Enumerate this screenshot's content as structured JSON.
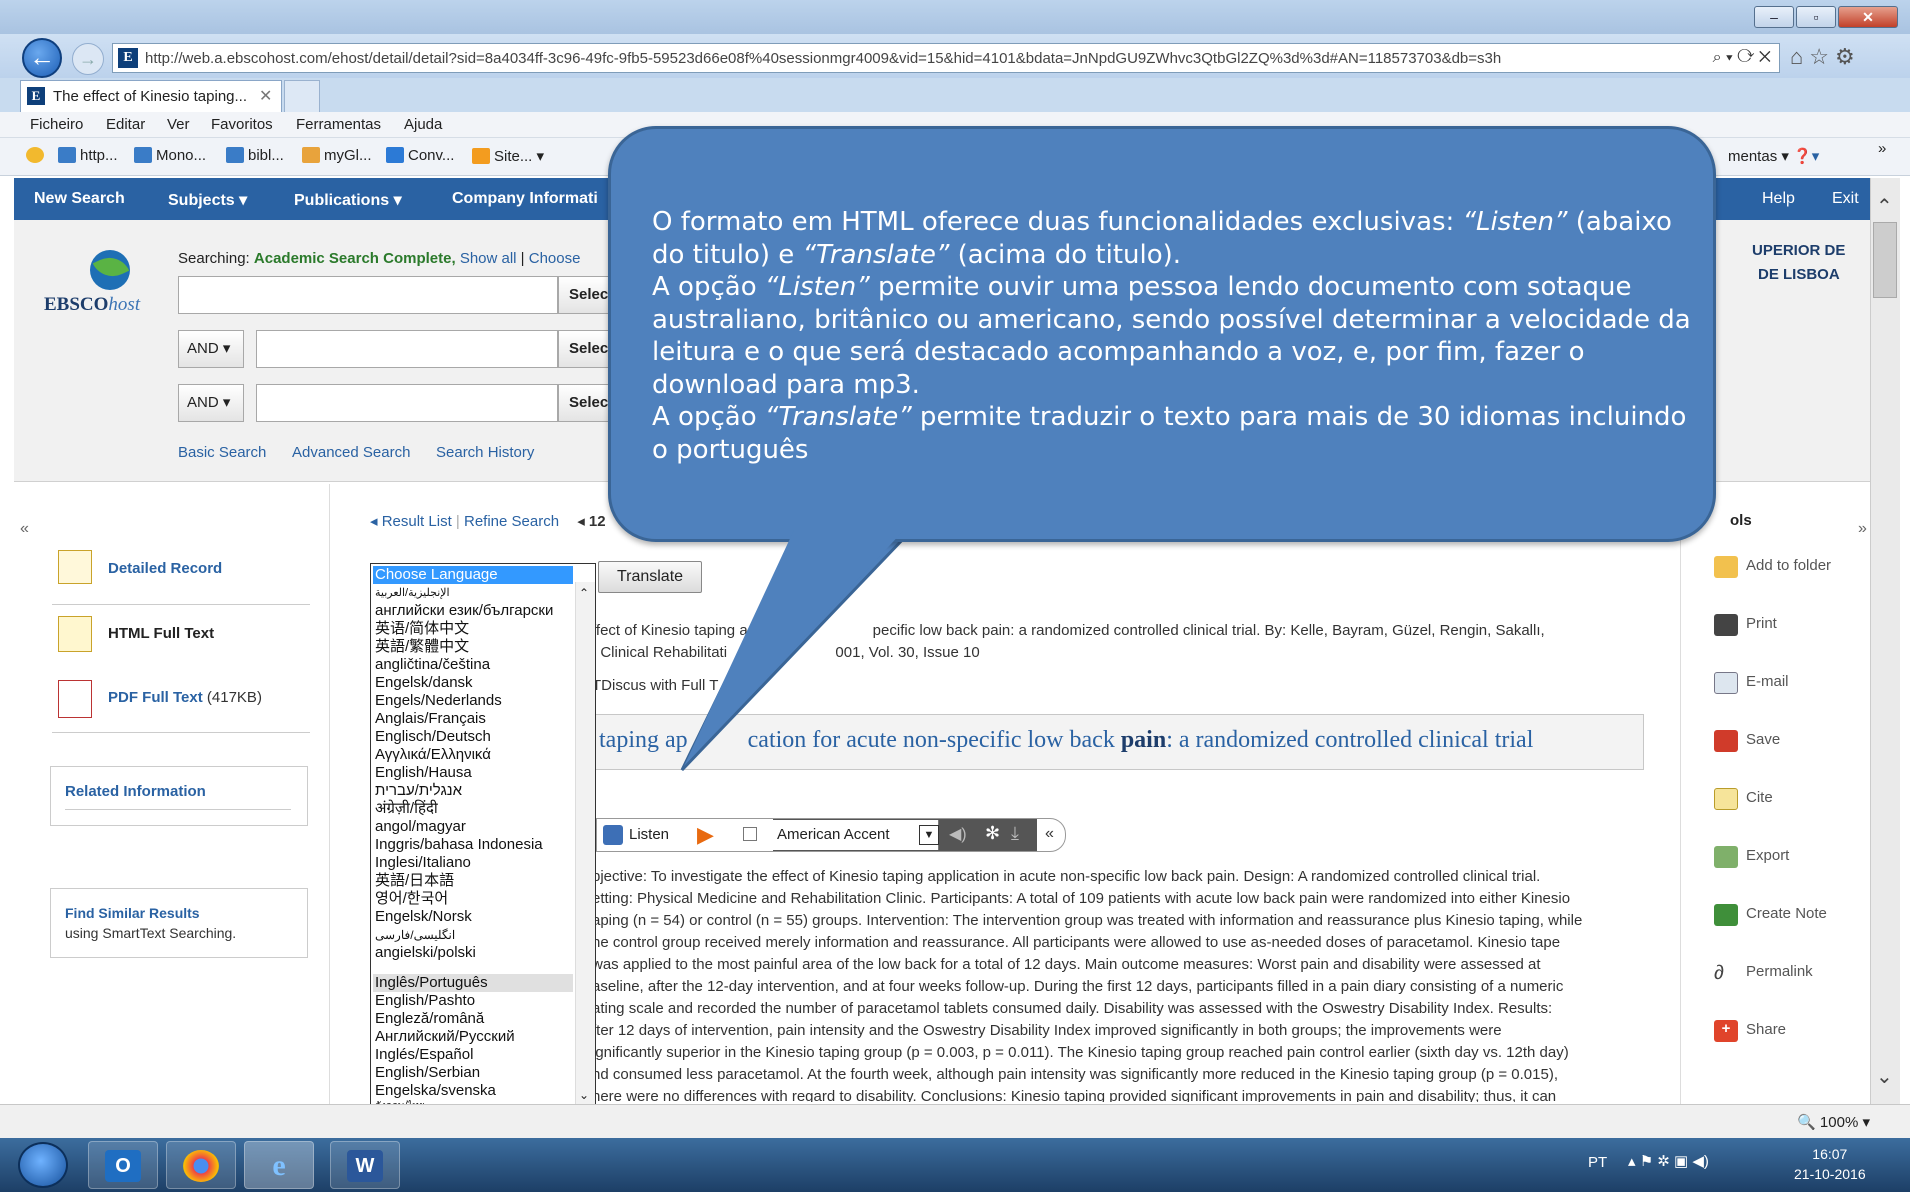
{
  "browser": {
    "url": "http://web.a.ebscohost.com/ehost/detail/detail?sid=8a4034ff-3c96-49fc-9fb5-59523d66e08f%40sessionmgr4009&vid=15&hid=4101&bdata=JnNpdGU9ZWhvc3QtbGl2ZQ%3d%3d#AN=118573703&db=s3h",
    "tab_title": "The effect of Kinesio taping...",
    "menu": [
      "Ficheiro",
      "Editar",
      "Ver",
      "Favoritos",
      "Ferramentas",
      "Ajuda"
    ],
    "favorites": [
      "http...",
      "Mono...",
      "bibl...",
      "myGl...",
      "Conv...",
      "Site..."
    ],
    "ferramentas_label": "mentas",
    "zoom": "100%"
  },
  "nav": {
    "new_search": "New Search",
    "subjects": "Subjects",
    "publications": "Publications",
    "company": "Company Informati",
    "help": "Help",
    "exit": "Exit"
  },
  "search": {
    "logo": "EBSCO",
    "logo_suffix": "host",
    "searching_label": "Searching:",
    "database": "Academic Search Complete,",
    "show_all": "Show all",
    "choose": "Choose",
    "select": "Select",
    "and": "AND",
    "basic": "Basic Search",
    "advanced": "Advanced Search",
    "history": "Search History",
    "institution_line1": "UPERIOR DE",
    "institution_line2": "DE LISBOA"
  },
  "left": {
    "detailed_record": "Detailed Record",
    "html_full_text": "HTML Full Text",
    "pdf_full_text": "PDF Full Text",
    "pdf_size": "(417KB)",
    "related_info": "Related Information",
    "find_similar": "Find Similar Results",
    "find_similar_sub": "using SmartText Searching."
  },
  "article": {
    "result_list": "Result List",
    "refine_search": "Refine Search",
    "page_num": "12",
    "translate": "Translate",
    "citation_line1": "ffect of Kinesio taping a                              pecific low back pain: a randomized controlled clinical trial. By: Kelle, Bayram, Güzel, Rengin, Sakallı,",
    "citation_line2": ", Clinical Rehabilitati                          001, Vol. 30, Issue 10",
    "citation_line3": "TDiscus with Full T",
    "title_before": "taping ap          cation for acute non-specific low back ",
    "title_bold": "pain",
    "title_after": ": a randomized controlled clinical trial",
    "listen": "Listen",
    "accent": "American Accent",
    "abstract": [
      "bjective: To investigate the effect of Kinesio taping application in acute non-specific low back pain. Design: A randomized controlled clinical trial.",
      "etting: Physical Medicine and Rehabilitation Clinic. Participants: A total of 109 patients with acute low back pain were randomized into either Kinesio",
      "aping (n = 54) or control (n = 55) groups. Intervention: The intervention group was treated with information and reassurance plus Kinesio taping, while",
      "he control group received merely information and reassurance. All participants were allowed to use as-needed doses of paracetamol. Kinesio tape",
      "was applied to the most painful area of the low back for a total of 12 days. Main outcome measures: Worst pain and disability were assessed at",
      "aseline, after the 12-day intervention, and at four weeks follow-up. During the first 12 days, participants filled in a pain diary consisting of a numeric",
      "ating scale and recorded the number of paracetamol tablets consumed daily. Disability was assessed with the Oswestry Disability Index. Results:",
      "fter 12 days of intervention, pain intensity and the Oswestry Disability Index improved significantly in both groups; the improvements were",
      "ignificantly superior in the Kinesio taping group (p = 0.003, p = 0.011). The Kinesio taping group reached pain control earlier (sixth day vs. 12th day)",
      "nd consumed less paracetamol. At the fourth week, although pain intensity was significantly more reduced in the Kinesio taping group (p = 0.015),",
      "here were no differences with regard to disability. Conclusions: Kinesio taping provided significant improvements in pain and disability; thus, it can"
    ]
  },
  "languages": [
    "Choose Language",
    "الإنجليزية/العربية",
    "английски език/български",
    "英语/简体中文",
    "英語/繁體中文",
    "angličtina/čeština",
    "Engelsk/dansk",
    "Engels/Nederlands",
    "Anglais/Français",
    "Englisch/Deutsch",
    "Αγγλικά/Ελληνικά",
    "English/Hausa",
    "אנגלית/עברית",
    "अंग्रेज़ी/हिंदी",
    "angol/magyar",
    "Inggris/bahasa Indonesia",
    "Inglesi/Italiano",
    "英語/日本語",
    "영어/한국어",
    "Engelsk/Norsk",
    "انگلیسی/فارسی",
    "angielski/polski",
    "Inglês/Português",
    "English/Pashto",
    "Engleză/română",
    "Английский/Русский",
    "Inglés/Español",
    "English/Serbian",
    "Engelska/svenska",
    "อังกฤษ/ไทย"
  ],
  "tools": {
    "header": "ols",
    "items": [
      "Add to folder",
      "Print",
      "E-mail",
      "Save",
      "Cite",
      "Export",
      "Create Note",
      "Permalink",
      "Share"
    ]
  },
  "callout": {
    "p1_a": "O formato em HTML oferece duas funcionalidades exclusivas: ",
    "p1_listen": "“Listen”",
    "p1_b": " (abaixo do titulo) e ",
    "p1_translate": "“Translate”",
    "p1_c": " (acima do titulo).",
    "p2_a": "A opção ",
    "p2_listen": "“Listen”",
    "p2_b": " permite ouvir uma pessoa lendo documento com sotaque australiano, britânico ou americano, sendo possível determinar a velocidade da leitura e o que será destacado acompanhando a voz, e, por fim, fazer o download para mp3.",
    "p3_a": "A opção ",
    "p3_translate": "“Translate”",
    "p3_b": " permite traduzir o texto para mais de 30 idiomas incluindo o português"
  },
  "taskbar": {
    "lang": "PT",
    "time": "16:07",
    "date": "21-10-2016"
  }
}
